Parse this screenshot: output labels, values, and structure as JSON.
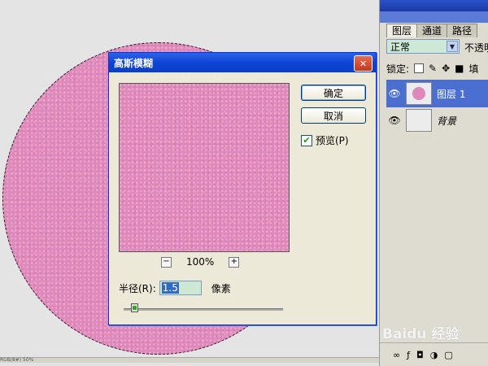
{
  "dialog": {
    "title": "高斯模糊",
    "close_icon": "close-icon",
    "ok_label": "确定",
    "cancel_label": "取消",
    "preview_label": "预览(P)",
    "preview_checked": true,
    "zoom_level": "100%",
    "zoom_out_label": "−",
    "zoom_in_label": "+",
    "radius_label": "半径(R):",
    "radius_value": "1.5",
    "radius_unit": "像素",
    "slider_fraction": 0.06
  },
  "layers_panel": {
    "tabs": [
      "图层",
      "通道",
      "路径"
    ],
    "blend_mode": "正常",
    "opacity_label": "不透明",
    "lock_label": "锁定:",
    "fill_label": "填",
    "layers": [
      {
        "name": "图层 1",
        "selected": true,
        "visible": true
      },
      {
        "name": "背景",
        "selected": false,
        "visible": true
      }
    ]
  },
  "statusbar": {
    "text": "RGB/8#) 50%"
  },
  "watermark": {
    "text": "Baidu 经验"
  },
  "colors": {
    "pink": "#de88bd",
    "titlebar": "#0f45d5",
    "selected": "#4a6fd0"
  }
}
